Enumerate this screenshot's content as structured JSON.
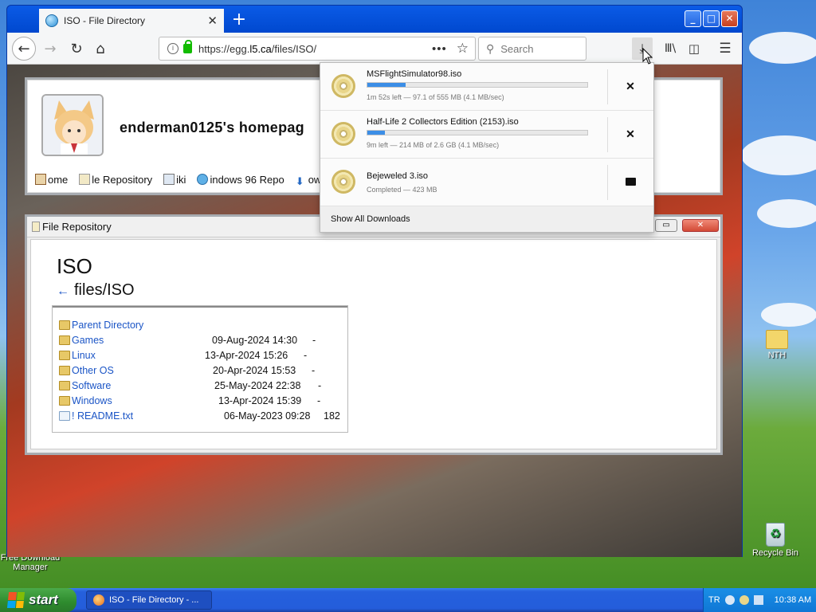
{
  "desktop": {
    "left_icon_label": "Free Download Manager",
    "recycle_label": "Recycle Bin",
    "folder_label": "NTH"
  },
  "browser": {
    "tab_title": "ISO - File Directory",
    "url_prefix": "https://egg.",
    "url_domain": "l5.ca",
    "url_path": "/files/ISO/",
    "search_placeholder": "Search"
  },
  "site": {
    "title": "enderman0125's homepag",
    "nav": [
      "ome",
      "le Repository",
      "iki",
      "indows 96 Repo",
      "own"
    ]
  },
  "file_window": {
    "title": "File Repository",
    "heading": "ISO",
    "path": "files/ISO",
    "rows": [
      {
        "name": "Parent Directory",
        "date": "",
        "size": ""
      },
      {
        "name": "Games",
        "date": "09-Aug-2024 14:30",
        "size": "-"
      },
      {
        "name": "Linux",
        "date": "13-Apr-2024 15:26",
        "size": "-"
      },
      {
        "name": "Other OS",
        "date": "20-Apr-2024 15:53",
        "size": "-"
      },
      {
        "name": "Software",
        "date": "25-May-2024 22:38",
        "size": "-"
      },
      {
        "name": "Windows",
        "date": "13-Apr-2024 15:39",
        "size": "-"
      },
      {
        "name": "! README.txt",
        "date": "06-May-2023 09:28",
        "size": "182"
      }
    ]
  },
  "downloads": {
    "items": [
      {
        "name": "MSFlightSimulator98.iso",
        "progress": 0.175,
        "status": "1m 52s left — 97.1 of 555 MB (4.1 MB/sec)",
        "action": "cancel"
      },
      {
        "name": "Half-Life 2 Collectors Edition (2153).iso",
        "progress": 0.08,
        "status": "9m left — 214 MB of 2.6 GB (4.1 MB/sec)",
        "action": "cancel"
      },
      {
        "name": "Bejeweled 3.iso",
        "progress": 1.0,
        "status": "Completed — 423 MB",
        "action": "open-folder"
      }
    ],
    "footer": "Show All Downloads"
  },
  "taskbar": {
    "start_label": "start",
    "task_label": "ISO - File Directory - ...",
    "tray_lang": "TR",
    "clock": "10:38 AM"
  }
}
